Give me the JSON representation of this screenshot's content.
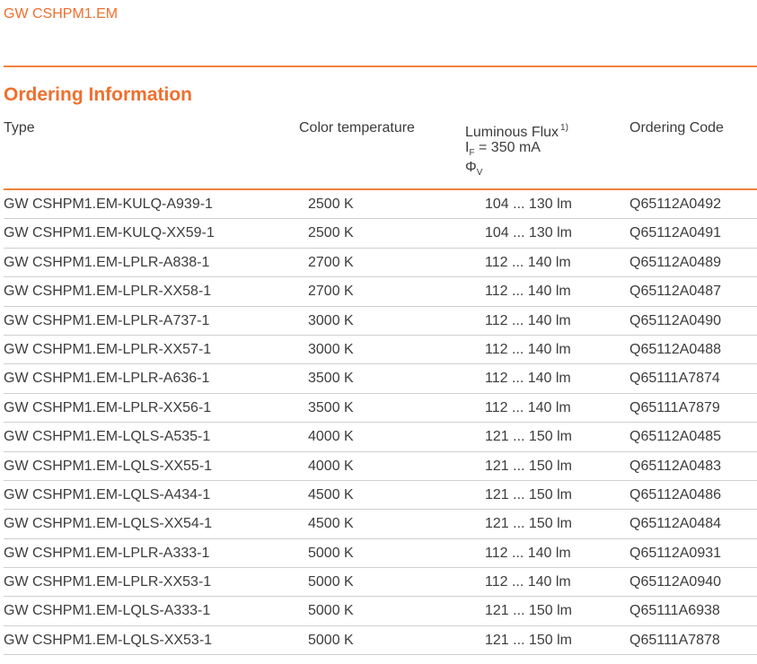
{
  "header": {
    "product": "GW CSHPM1.EM"
  },
  "section": {
    "title": "Ordering Information"
  },
  "columns": {
    "type": "Type",
    "color_temperature": "Color temperature",
    "flux_title": "Luminous Flux",
    "flux_footnote": "1)",
    "flux_condition_symbol": "I",
    "flux_condition_subscript": "F",
    "flux_condition_value": "= 350 mA",
    "flux_symbol": "Φ",
    "flux_symbol_subscript": "V",
    "ordering_code": "Ordering Code"
  },
  "rows": [
    {
      "type": "GW CSHPM1.EM-KULQ-A939-1",
      "color_temperature": "2500 K",
      "luminous_flux": "104 ... 130 lm",
      "ordering_code": "Q65112A0492"
    },
    {
      "type": "GW CSHPM1.EM-KULQ-XX59-1",
      "color_temperature": "2500 K",
      "luminous_flux": "104 ... 130 lm",
      "ordering_code": "Q65112A0491"
    },
    {
      "type": "GW CSHPM1.EM-LPLR-A838-1",
      "color_temperature": "2700 K",
      "luminous_flux": "112 ... 140 lm",
      "ordering_code": "Q65112A0489"
    },
    {
      "type": "GW CSHPM1.EM-LPLR-XX58-1",
      "color_temperature": "2700 K",
      "luminous_flux": "112 ... 140 lm",
      "ordering_code": "Q65112A0487"
    },
    {
      "type": "GW CSHPM1.EM-LPLR-A737-1",
      "color_temperature": "3000 K",
      "luminous_flux": "112 ... 140 lm",
      "ordering_code": "Q65112A0490"
    },
    {
      "type": "GW CSHPM1.EM-LPLR-XX57-1",
      "color_temperature": "3000 K",
      "luminous_flux": "112 ... 140 lm",
      "ordering_code": "Q65112A0488"
    },
    {
      "type": "GW CSHPM1.EM-LPLR-A636-1",
      "color_temperature": "3500 K",
      "luminous_flux": "112 ... 140 lm",
      "ordering_code": "Q65111A7874"
    },
    {
      "type": "GW CSHPM1.EM-LPLR-XX56-1",
      "color_temperature": "3500 K",
      "luminous_flux": "112 ... 140 lm",
      "ordering_code": "Q65111A7879"
    },
    {
      "type": "GW CSHPM1.EM-LQLS-A535-1",
      "color_temperature": "4000 K",
      "luminous_flux": "121 ... 150 lm",
      "ordering_code": "Q65112A0485"
    },
    {
      "type": "GW CSHPM1.EM-LQLS-XX55-1",
      "color_temperature": "4000 K",
      "luminous_flux": "121 ... 150 lm",
      "ordering_code": "Q65112A0483"
    },
    {
      "type": "GW CSHPM1.EM-LQLS-A434-1",
      "color_temperature": "4500 K",
      "luminous_flux": "121 ... 150 lm",
      "ordering_code": "Q65112A0486"
    },
    {
      "type": "GW CSHPM1.EM-LQLS-XX54-1",
      "color_temperature": "4500 K",
      "luminous_flux": "121 ... 150 lm",
      "ordering_code": "Q65112A0484"
    },
    {
      "type": "GW CSHPM1.EM-LPLR-A333-1",
      "color_temperature": "5000 K",
      "luminous_flux": "112 ... 140 lm",
      "ordering_code": "Q65112A0931"
    },
    {
      "type": "GW CSHPM1.EM-LPLR-XX53-1",
      "color_temperature": "5000 K",
      "luminous_flux": "112 ... 140 lm",
      "ordering_code": "Q65112A0940"
    },
    {
      "type": "GW CSHPM1.EM-LQLS-A333-1",
      "color_temperature": "5000 K",
      "luminous_flux": "121 ... 150 lm",
      "ordering_code": "Q65111A6938"
    },
    {
      "type": "GW CSHPM1.EM-LQLS-XX53-1",
      "color_temperature": "5000 K",
      "luminous_flux": "121 ... 150 lm",
      "ordering_code": "Q65111A7878"
    }
  ],
  "colors": {
    "accent": "#f06f2d",
    "rule": "#f0823c",
    "text": "#3c3c3c",
    "row_divider": "#cfcfcf"
  }
}
